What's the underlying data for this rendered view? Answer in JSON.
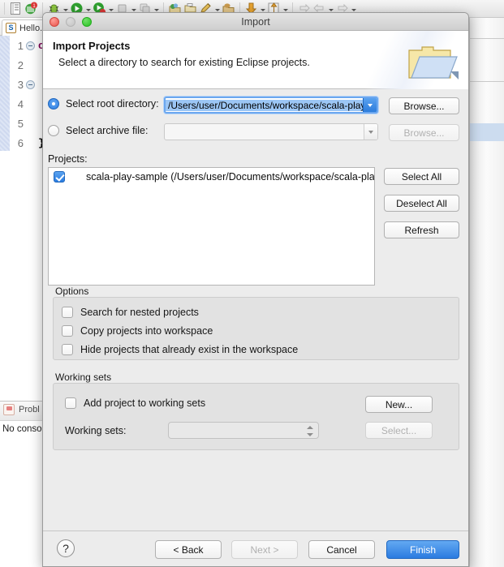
{
  "ide": {
    "editor_tab_label": "Hello.",
    "editor_tab_icon": "scala-file-icon",
    "code_lines": [
      {
        "num": "1",
        "fold": true,
        "text": "ob"
      },
      {
        "num": "2",
        "fold": false,
        "text": ""
      },
      {
        "num": "3",
        "fold": true,
        "text": ""
      },
      {
        "num": "4",
        "fold": false,
        "text": ""
      },
      {
        "num": "5",
        "fold": false,
        "text": ""
      },
      {
        "num": "6",
        "fold": false,
        "text": "}"
      }
    ],
    "problems_tab_label": "Probl",
    "console_message": "No conso",
    "toolbar_icons": [
      "debug-bug-icon",
      "run-icon",
      "run-coverage-icon",
      "terminate-icon",
      "terminate-all-icon",
      "new-java-package-icon",
      "new-folder-icon",
      "edit-icon",
      "open-type-icon",
      "previous-annotation-icon",
      "next-annotation-icon",
      "last-edit-location-icon",
      "back-icon",
      "forward-icon"
    ]
  },
  "dialog": {
    "window_title": "Import",
    "traffic_lights": [
      "close",
      "minimize",
      "zoom"
    ],
    "header": {
      "heading": "Import Projects",
      "subheading": "Select a directory to search for existing Eclipse projects.",
      "icon": "import-folder-icon"
    },
    "source": {
      "root_directory": {
        "radio_label": "Select root directory:",
        "selected": true,
        "value": "/Users/user/Documents/workspace/scala-play-",
        "browse_label": "Browse...",
        "browse_enabled": true
      },
      "archive_file": {
        "radio_label": "Select archive file:",
        "selected": false,
        "value": "",
        "browse_label": "Browse...",
        "browse_enabled": false
      }
    },
    "projects": {
      "label": "Projects:",
      "items": [
        {
          "checked": true,
          "text": "scala-play-sample (/Users/user/Documents/workspace/scala-play-sam"
        }
      ],
      "buttons": [
        {
          "label": "Select All",
          "enabled": true
        },
        {
          "label": "Deselect All",
          "enabled": true
        },
        {
          "label": "Refresh",
          "enabled": true
        }
      ]
    },
    "options": {
      "title": "Options",
      "checkboxes": [
        {
          "label": "Search for nested projects",
          "checked": false
        },
        {
          "label": "Copy projects into workspace",
          "checked": false
        },
        {
          "label": "Hide projects that already exist in the workspace",
          "checked": false
        }
      ]
    },
    "working_sets": {
      "title": "Working sets",
      "add_checkbox": {
        "label": "Add project to working sets",
        "checked": false
      },
      "new_button": {
        "label": "New...",
        "enabled": true
      },
      "combo_label": "Working sets:",
      "combo_value": "",
      "select_button": {
        "label": "Select...",
        "enabled": false
      }
    },
    "footer": {
      "help_glyph": "?",
      "buttons": [
        {
          "label": "< Back",
          "enabled": true,
          "primary": false
        },
        {
          "label": "Next >",
          "enabled": false,
          "primary": false
        },
        {
          "label": "Cancel",
          "enabled": true,
          "primary": false
        },
        {
          "label": "Finish",
          "enabled": true,
          "primary": true
        }
      ]
    }
  },
  "colors": {
    "accent_blue": "#2b7ce0",
    "dialog_bg": "#ececec",
    "selection_blue": "#9cc6f5"
  }
}
